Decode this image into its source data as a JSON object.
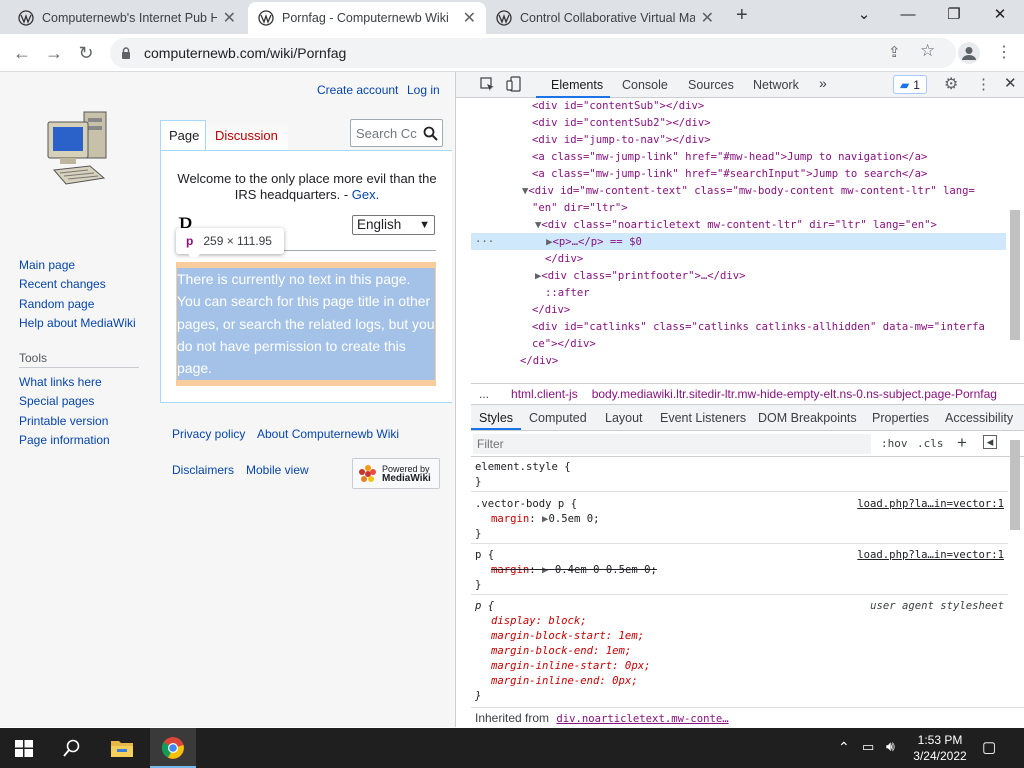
{
  "browser": {
    "tabs": [
      {
        "title": "Computernewb's Internet Pub He"
      },
      {
        "title": "Pornfag - Computernewb Wiki"
      },
      {
        "title": "Control Collaborative Virtual Ma"
      }
    ],
    "url": "computernewb.com/wiki/Pornfag"
  },
  "wiki": {
    "create_account": "Create account",
    "log_in": "Log in",
    "tab_page": "Page",
    "tab_discussion": "Discussion",
    "search_placeholder": "Search Cc",
    "notice_text": "Welcome to the only place more evil than the IRS headquarters. -",
    "notice_link": "Gex.",
    "title_partial": "P",
    "language": "English",
    "tooltip_tag": "p",
    "tooltip_dims": "259 × 111.95",
    "paragraph": "There is currently no text in this page. You can search for this page title in other pages, or search the related logs, but you do not have permission to create this page.",
    "nav": [
      "Main page",
      "Recent changes",
      "Random page",
      "Help about MediaWiki"
    ],
    "tools_heading": "Tools",
    "tools": [
      "What links here",
      "Special pages",
      "Printable version",
      "Page information"
    ],
    "footer": [
      "Privacy policy",
      "About Computernewb Wiki",
      "Disclaimers",
      "Mobile view"
    ],
    "powered_by_line1": "Powered by",
    "powered_by_line2": "MediaWiki"
  },
  "devtools": {
    "tabs": [
      "Elements",
      "Console",
      "Sources",
      "Network"
    ],
    "more": "»",
    "issues_count": "1",
    "dom_lines": [
      "<div id=\"contentSub\"></div>",
      "<div id=\"contentSub2\"></div>",
      "<div id=\"jump-to-nav\"></div>",
      "<a class=\"mw-jump-link\" href=\"#mw-head\">Jump to navigation</a>",
      "<a class=\"mw-jump-link\" href=\"#searchInput\">Jump to search</a>",
      "<div id=\"mw-content-text\" class=\"mw-body-content mw-content-ltr\" lang=",
      "\"en\" dir=\"ltr\">",
      "<div class=\"noarticletext mw-content-ltr\" dir=\"ltr\" lang=\"en\">",
      "<p>…</p> == $0",
      "</div>",
      "<div class=\"printfooter\">…</div>",
      "::after",
      "</div>",
      "<div id=\"catlinks\" class=\"catlinks catlinks-allhidden\" data-mw=\"interfa",
      "ce\"></div>",
      "</div>"
    ],
    "breadcrumbs": [
      "...",
      "html.client-js",
      "body.mediawiki.ltr.sitedir-ltr.mw-hide-empty-elt.ns-0.ns-subject.page-Pornfag"
    ],
    "style_tabs": [
      "Styles",
      "Computed",
      "Layout",
      "Event Listeners",
      "DOM Breakpoints",
      "Properties",
      "Accessibility"
    ],
    "filter_placeholder": "Filter",
    "hov": ":hov",
    "cls": ".cls",
    "rules": {
      "element_style": "element.style {",
      "vector_selector": ".vector-body p {",
      "vector_prop": "margin",
      "vector_value": "0.5em 0;",
      "vector_src": "load.php?la…in=vector:1",
      "p_selector": "p {",
      "p_prop": "margin",
      "p_value": "0.4em 0 0.5em 0;",
      "p_src": "load.php?la…in=vector:1",
      "ua_selector": "p {",
      "ua_src": "user agent stylesheet",
      "ua_props": [
        "display: block;",
        "margin-block-start: 1em;",
        "margin-block-end: 1em;",
        "margin-inline-start: 0px;",
        "margin-inline-end: 0px;"
      ],
      "close": "}"
    },
    "inherited_label": "Inherited from",
    "inherited_from": "div.noarticletext.mw-conte…"
  },
  "taskbar": {
    "time": "1:53 PM",
    "date": "3/24/2022"
  }
}
